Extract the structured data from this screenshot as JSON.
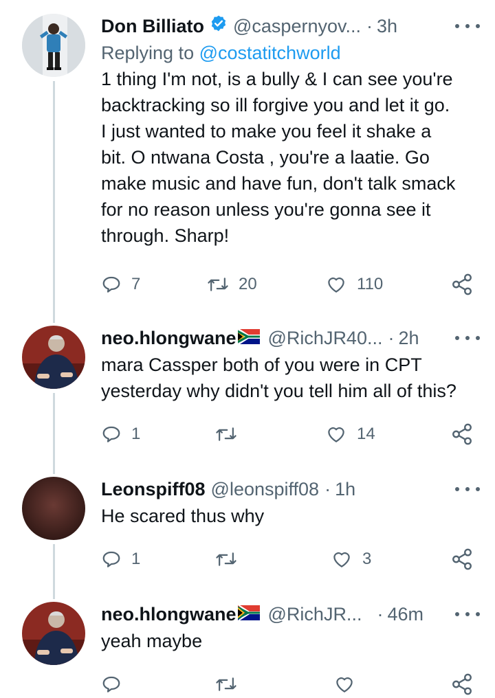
{
  "tweets": [
    {
      "name": "Don Billiato",
      "verified": true,
      "handle": "@caspernyov...",
      "time": "3h",
      "reply_label": "Replying to",
      "reply_to": "@costatitchworld",
      "text_lines": [
        "1 thing I'm not, is a bully & I can see you're",
        "backtracking so ill forgive you and let it go.",
        "I just wanted to make you feel it shake a",
        "bit. O ntwana Costa , you're a laatie. Go",
        "make music and have fun, don't talk smack",
        "for no reason unless you're gonna see it",
        "through. Sharp!"
      ],
      "replies": "7",
      "retweets": "20",
      "likes": "110"
    },
    {
      "name": "neo.hlongwane",
      "flag": "south-africa-flag",
      "handle": "@RichJR40...",
      "time": "2h",
      "text_lines": [
        "mara Cassper both of you were in CPT",
        "yesterday why didn't you tell him all of this?"
      ],
      "replies": "1",
      "retweets": "",
      "likes": "14"
    },
    {
      "name": "Leonspiff08",
      "handle": "@leonspiff08",
      "time": "1h",
      "text_lines": [
        "He scared thus why"
      ],
      "replies": "1",
      "retweets": "",
      "likes": "3"
    },
    {
      "name": "neo.hlongwane",
      "flag": "south-africa-flag",
      "handle": "@RichJR...",
      "time": "46m",
      "text_lines": [
        "yeah maybe"
      ],
      "replies": "",
      "retweets": "",
      "likes": ""
    }
  ],
  "colors": {
    "text": "#0f1419",
    "secondary": "#536471",
    "link": "#1d9bf0",
    "thread_line": "#cfd9de"
  }
}
